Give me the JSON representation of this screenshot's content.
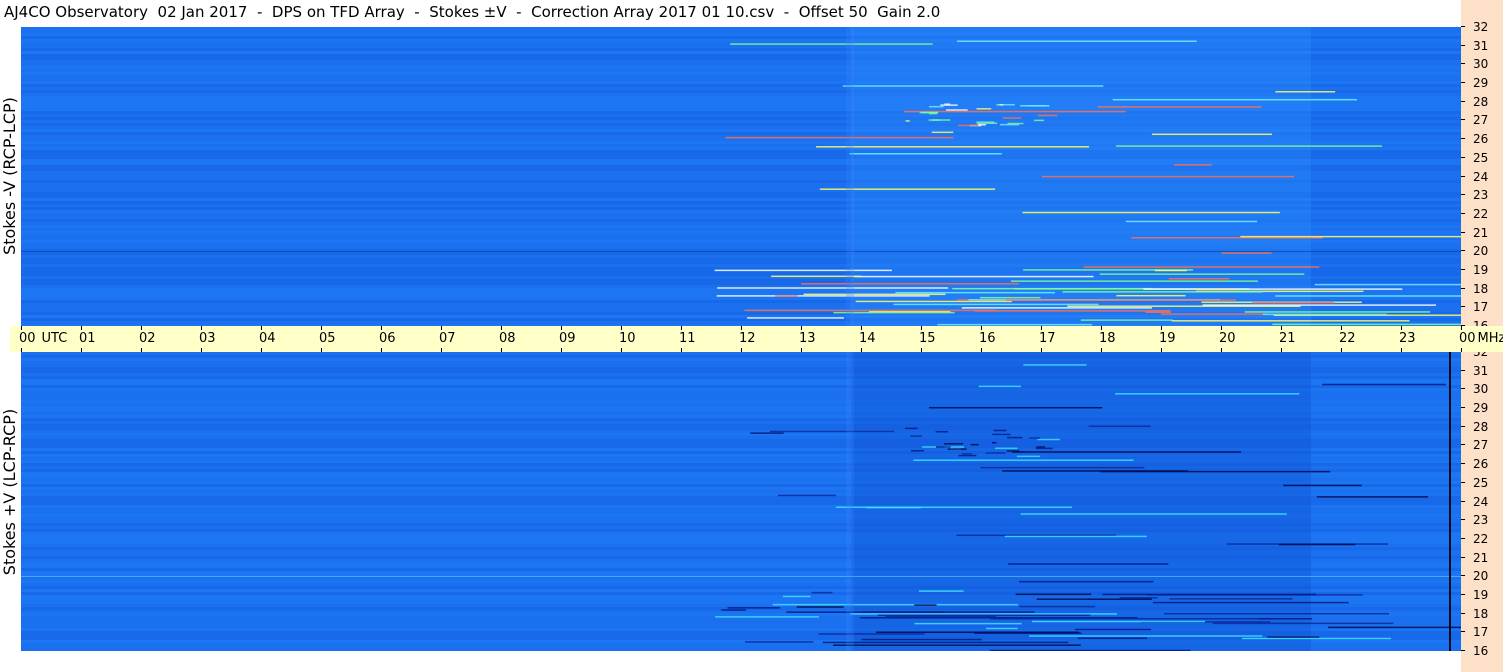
{
  "title": "AJ4CO Observatory  02 Jan 2017  -  DPS on TFD Array  -  Stokes ±V  -  Correction Array 2017 01 10.csv  -  Offset 50  Gain 2.0",
  "panels": [
    {
      "ylabel": "Stokes -V (RCP-LCP)"
    },
    {
      "ylabel": "Stokes +V (LCP-RCP)"
    }
  ],
  "utc_axis": {
    "unit_label": "UTC",
    "hours": [
      "00",
      "01",
      "02",
      "03",
      "04",
      "05",
      "06",
      "07",
      "08",
      "09",
      "10",
      "11",
      "12",
      "13",
      "14",
      "15",
      "16",
      "17",
      "18",
      "19",
      "20",
      "21",
      "22",
      "23",
      "00"
    ],
    "end_unit": "MHz"
  },
  "freq_ticks": [
    "32",
    "31",
    "30",
    "29",
    "28",
    "27",
    "26",
    "25",
    "24",
    "23",
    "22",
    "21",
    "20",
    "19",
    "18",
    "17",
    "16"
  ],
  "colors": {
    "background_blue": "#1a6ff0",
    "axis_bar": "#ffffc8",
    "right_strip": "#fde0c8"
  }
}
